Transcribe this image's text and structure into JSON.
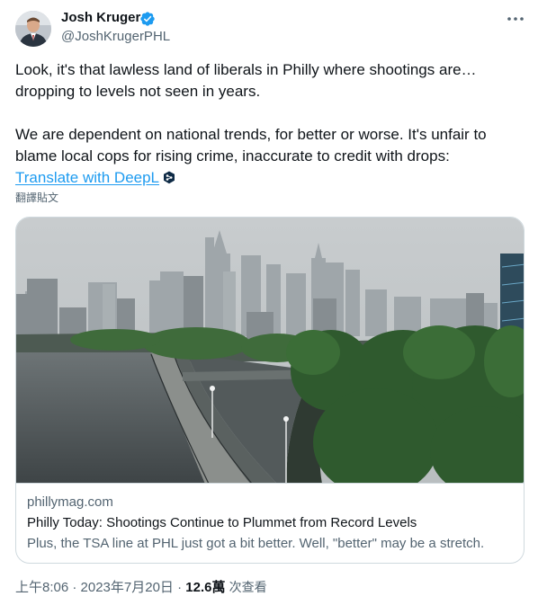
{
  "author": {
    "name": "Josh Kruger",
    "handle": "@JoshKrugerPHL",
    "verified": true
  },
  "tweet": {
    "paragraph1": "Look, it's that lawless land of liberals in Philly where shootings are…dropping to levels not seen in years.",
    "paragraph2": "We are dependent on national trends, for better or worse. It's unfair to blame local cops for rising crime, inaccurate to credit with drops:",
    "translate_link": "Translate with DeepL",
    "translate_post": "翻譯貼文"
  },
  "card": {
    "domain": "phillymag.com",
    "title": "Philly Today: Shootings Continue to Plummet from Record Levels",
    "description": "Plus, the TSA line at PHL just got a bit better. Well, \"better\" may be a stretch."
  },
  "meta": {
    "timestamp": "上午8:06 · 2023年7月20日",
    "separator": "·",
    "views_count": "12.6萬",
    "views_label": "次查看"
  },
  "colors": {
    "accent": "#1d9bf0",
    "text_primary": "#0f1419",
    "text_secondary": "#536471",
    "border": "#cfd9de"
  },
  "icons": {
    "verified": "verified-badge-icon",
    "more": "more-dots-icon",
    "deepl": "deepl-icon"
  }
}
